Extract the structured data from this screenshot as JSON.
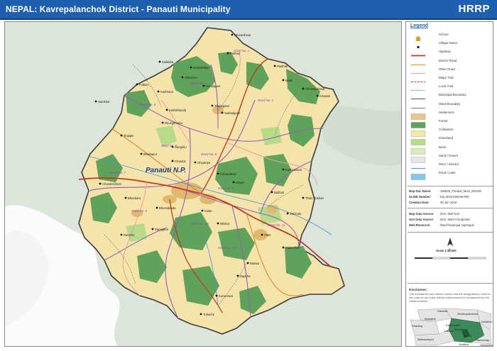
{
  "header": {
    "title": "NEPAL: Kavrepalanchok District - Panauti Municipality",
    "brand": "HRRP"
  },
  "map": {
    "municipality_label": "Panauti N.P.",
    "village_labels": [
      "Dhaneshwar",
      "Pokhari",
      "Ganeshthan",
      "Kalidaha",
      "Chitrasen",
      "Pasthali",
      "Malpi",
      "Fulbari",
      "Karkhana",
      "Hundigaun",
      "Thapagaun",
      "Subbalgaun",
      "Chhimkeshwar",
      "Khopasi",
      "Kashikhanda",
      "Samkhar",
      "Dhungkharka",
      "Tinpiple",
      "Sangkhu",
      "Bhaktapur",
      "Chaukot",
      "Ghyampe",
      "Chhatrabesi",
      "Bhujel",
      "Kusheshwar",
      "Balthali",
      "Thulo Pokhari",
      "Dalchoki",
      "Chandeshwori",
      "Bhandara",
      "Bhumidanda",
      "Kolati",
      "Bhirkot",
      "Ramche",
      "Sanagaun",
      "Patle",
      "Palanchok",
      "Batase",
      "Dapcha",
      "Kunta Besi",
      "Tukuche"
    ],
    "ward_labels": [
      "Ward No. 1",
      "Ward No. 2",
      "Ward No. 3",
      "Ward No. 4",
      "Ward No. 5",
      "Ward No. 6",
      "Ward No. 7",
      "Ward No. 8",
      "Ward No. 9",
      "Ward No. 10",
      "Ward No. 11",
      "Ward No. 12"
    ]
  },
  "legend": {
    "title": "Legend",
    "items": [
      {
        "label": "School",
        "symbol": "school-icon"
      },
      {
        "label": "Village Name",
        "symbol": "village-icon"
      },
      {
        "label": "Highway",
        "symbol": "highway-line",
        "color": "#c0392b"
      },
      {
        "label": "District Road",
        "symbol": "district-road-line",
        "color": "#e08a2c"
      },
      {
        "label": "Other Road",
        "symbol": "other-road-line",
        "color": "#e8a0a0"
      },
      {
        "label": "Major Trail",
        "symbol": "major-trail-line",
        "color": "#c0392b"
      },
      {
        "label": "Local Trail",
        "symbol": "local-trail-line",
        "color": "#555555"
      },
      {
        "label": "Municipal Boundary",
        "symbol": "municipal-boundary-line",
        "color": "#555555"
      },
      {
        "label": "Ward Boundary",
        "symbol": "ward-boundary-line",
        "color": "#8e5fbf"
      },
      {
        "label": "Settlement",
        "symbol": "settlement-fill",
        "color": "#e6c98a"
      },
      {
        "label": "Forest",
        "symbol": "forest-fill",
        "color": "#5fa25a"
      },
      {
        "label": "Cultivation",
        "symbol": "cultivation-fill",
        "color": "#f7e7a6"
      },
      {
        "label": "Grassland",
        "symbol": "grassland-fill",
        "color": "#b6dc8a"
      },
      {
        "label": "Bush",
        "symbol": "bush-fill",
        "color": "#d8edb8"
      },
      {
        "label": "Sand / Gravel",
        "symbol": "sand-fill",
        "color": "#e6e6e6"
      },
      {
        "label": "River / Stream",
        "symbol": "river-line",
        "color": "#4a90e2"
      },
      {
        "label": "Pond / Lake",
        "symbol": "pond-fill",
        "color": "#7ec8f0"
      }
    ],
    "meta": [
      {
        "key": "Map Doc Name:",
        "value": "180628_Panauti_Muni_ID0109"
      },
      {
        "key": "GLIDE Number:",
        "value": "EQ-2015-000048-NPL"
      },
      {
        "key": "Creation Date:",
        "value": "30 Jun 2018"
      }
    ],
    "sources": [
      {
        "key": "Map Data Source:",
        "value": "DoS, MoFALD"
      },
      {
        "key": "Geo Data Source:",
        "value": "DoS, MoHA Geoportal"
      },
      {
        "key": "Web Resource:",
        "value": "http://hrrpnepal.org/maps/"
      }
    ],
    "scale": "Scale 1:35,000",
    "disclaimer_title": "Disclaimer:",
    "disclaimer_text": "The boundaries and names shown and the designations used on this map do not imply official endorsement or acceptance by the United Nations"
  },
  "inset": {
    "labels": [
      "Rasuwa",
      "Sindhupalchowk",
      "Dhading",
      "Nuwakot",
      "Dolakha",
      "Kathmandu",
      "Lalitpur",
      "Bhaktapur",
      "Kavre",
      "Makawanpur",
      "Ramechap",
      "Sindhuli",
      "Okhaldhunga"
    ]
  }
}
